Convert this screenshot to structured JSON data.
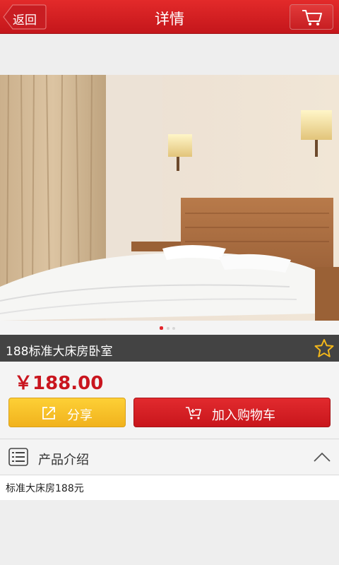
{
  "header": {
    "back_label": "返回",
    "title": "详情",
    "cart_icon": "cart-icon"
  },
  "product": {
    "name": "188标准大床房卧室",
    "price": "￥188.00",
    "image_count": 3,
    "active_image": 1
  },
  "actions": {
    "share_label": "分享",
    "add_to_cart_label": "加入购物车"
  },
  "intro": {
    "section_title": "产品介绍",
    "text": "标准大床房188元",
    "expanded": true
  },
  "colors": {
    "brand_red": "#c4161b",
    "share_yellow": "#f5bd24",
    "price_red": "#c9151e"
  }
}
